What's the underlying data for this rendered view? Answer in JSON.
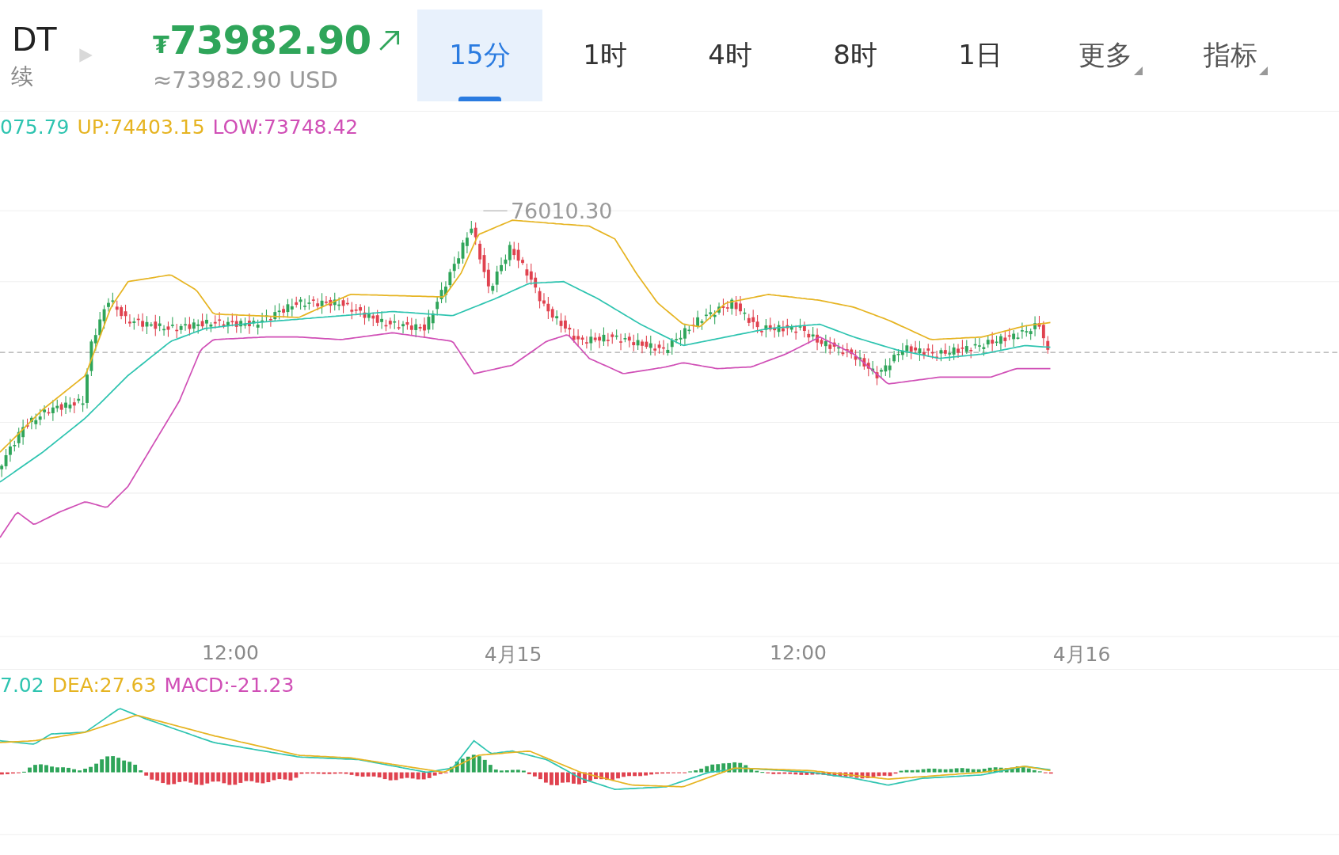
{
  "symbol": {
    "name": "DT",
    "subtitle": "续"
  },
  "price": {
    "currency": "₮",
    "value": "73982.90",
    "usd": "≈73982.90 USD"
  },
  "tabs": [
    {
      "label": "15分",
      "selected": true,
      "kind": "period"
    },
    {
      "label": "1时",
      "selected": false,
      "kind": "period"
    },
    {
      "label": "4时",
      "selected": false,
      "kind": "period"
    },
    {
      "label": "8时",
      "selected": false,
      "kind": "period"
    },
    {
      "label": "1日",
      "selected": false,
      "kind": "period"
    },
    {
      "label": "更多",
      "selected": false,
      "kind": "dropdown"
    },
    {
      "label": "指标",
      "selected": false,
      "kind": "dropdown"
    }
  ],
  "main_legend": [
    {
      "text": "075.79",
      "color": "#2ec4b0"
    },
    {
      "text": "UP:74403.15",
      "color": "#e6b422"
    },
    {
      "text": "LOW:73748.42",
      "color": "#d04fb6"
    }
  ],
  "max_marker": "76010.30",
  "x_axis": [
    "12:00",
    "4月15",
    "12:00",
    "4月16"
  ],
  "macd_legend": [
    {
      "text": "7.02",
      "color": "#2ec4b0"
    },
    {
      "text": "DEA:27.63",
      "color": "#e6b422"
    },
    {
      "text": "MACD:-21.23",
      "color": "#d04fb6"
    }
  ]
}
